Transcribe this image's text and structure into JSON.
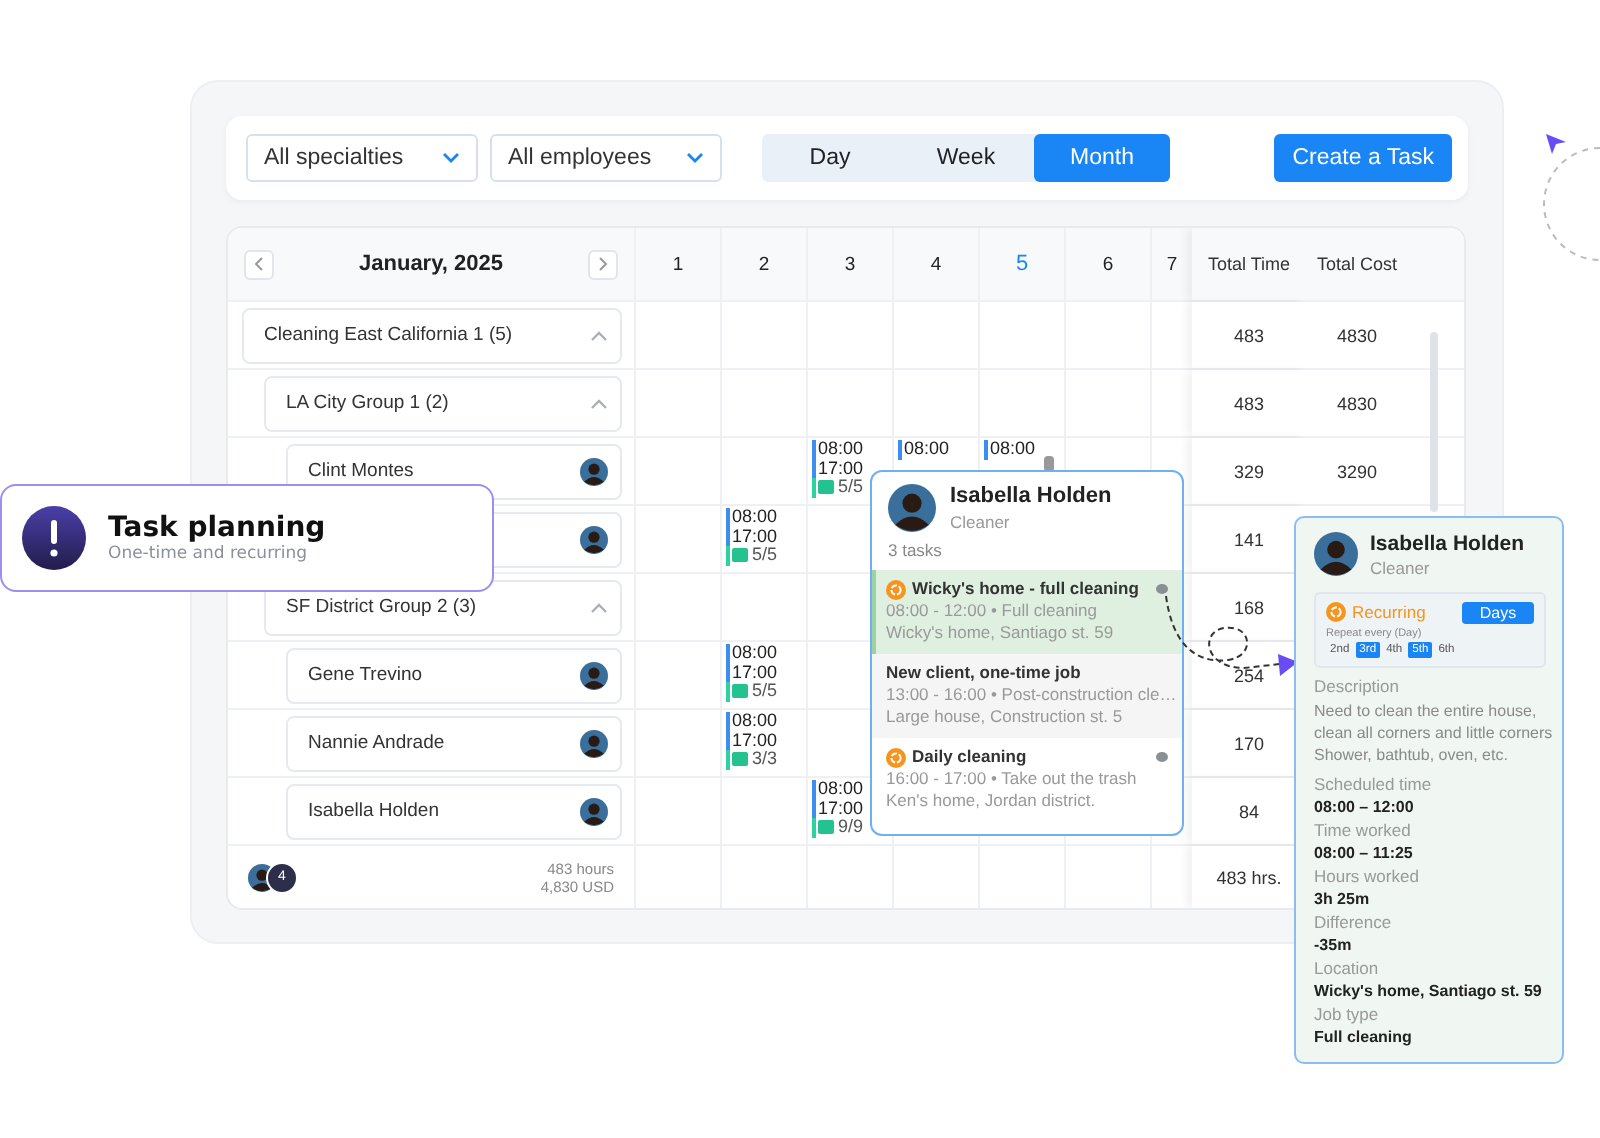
{
  "toolbar": {
    "filters": [
      {
        "value": "All specialties"
      },
      {
        "value": "All employees"
      }
    ],
    "views": [
      {
        "label": "Day",
        "selected": false
      },
      {
        "label": "Week",
        "selected": false
      },
      {
        "label": "Month",
        "selected": true
      }
    ],
    "create_button": "Create a Task"
  },
  "calendar": {
    "month": "January, 2025",
    "days": [
      {
        "label": "1",
        "selected": false
      },
      {
        "label": "2",
        "selected": false
      },
      {
        "label": "3",
        "selected": false
      },
      {
        "label": "4",
        "selected": false
      },
      {
        "label": "5",
        "selected": true
      },
      {
        "label": "6",
        "selected": false
      },
      {
        "label": "7",
        "selected": false
      }
    ],
    "total_columns": [
      "Total Time",
      "Total Cost"
    ],
    "tree": [
      {
        "kind": "group",
        "label": "Cleaning East California 1 (5)",
        "expanded": true,
        "total_time": "483",
        "total_cost": "4830",
        "cells": [
          {
            "kind": "empty"
          },
          {
            "kind": "empty"
          },
          {
            "kind": "empty"
          },
          {
            "kind": "empty"
          },
          {
            "kind": "empty"
          },
          {
            "kind": "empty"
          },
          {
            "kind": "empty"
          }
        ],
        "children": [
          {
            "kind": "group",
            "label": "LA City Group 1 (2)",
            "expanded": true,
            "total_time": "483",
            "total_cost": "4830",
            "cells": [
              {
                "kind": "empty"
              },
              {
                "kind": "empty"
              },
              {
                "kind": "empty"
              },
              {
                "kind": "empty"
              },
              {
                "kind": "empty"
              },
              {
                "kind": "empty"
              },
              {
                "kind": "empty"
              }
            ],
            "children": [
              {
                "kind": "employee",
                "name": "Clint Montes",
                "total_time": "329",
                "total_cost": "3290",
                "cells": [
                  {
                    "kind": "empty"
                  },
                  {
                    "kind": "empty"
                  },
                  {
                    "kind": "shift",
                    "start": "08:00",
                    "end": "17:00",
                    "count": "5/5",
                    "note": false
                  },
                  {
                    "kind": "shift",
                    "start": "08:00",
                    "note": false
                  },
                  {
                    "kind": "shift",
                    "start": "08:00",
                    "note": true
                  },
                  {
                    "kind": "empty"
                  },
                  {
                    "kind": "empty"
                  }
                ]
              },
              {
                "kind": "employee",
                "total_time": "141",
                "cells": [
                  {
                    "kind": "empty"
                  },
                  {
                    "kind": "shift",
                    "start": "08:00",
                    "end": "17:00",
                    "count": "5/5",
                    "note": false
                  },
                  {
                    "kind": "empty"
                  },
                  {
                    "kind": "empty"
                  },
                  {
                    "kind": "empty"
                  },
                  {
                    "kind": "empty"
                  },
                  {
                    "kind": "empty"
                  }
                ]
              }
            ]
          },
          {
            "kind": "group",
            "label": "SF District Group 2 (3)",
            "expanded": true,
            "total_time": "168",
            "cells": [
              {
                "kind": "empty"
              },
              {
                "kind": "empty"
              },
              {
                "kind": "empty"
              },
              {
                "kind": "empty"
              },
              {
                "kind": "empty"
              },
              {
                "kind": "empty"
              },
              {
                "kind": "empty"
              }
            ],
            "children": [
              {
                "kind": "employee",
                "name": "Gene Trevino",
                "total_time": "254",
                "cells": [
                  {
                    "kind": "empty"
                  },
                  {
                    "kind": "shift",
                    "start": "08:00",
                    "end": "17:00",
                    "count": "5/5",
                    "note": false
                  },
                  {
                    "kind": "empty"
                  },
                  {
                    "kind": "empty"
                  },
                  {
                    "kind": "empty"
                  },
                  {
                    "kind": "empty"
                  },
                  {
                    "kind": "empty"
                  }
                ]
              },
              {
                "kind": "employee",
                "name": "Nannie Andrade",
                "total_time": "170",
                "cells": [
                  {
                    "kind": "empty"
                  },
                  {
                    "kind": "shift",
                    "start": "08:00",
                    "end": "17:00",
                    "count": "3/3",
                    "note": false
                  },
                  {
                    "kind": "empty"
                  },
                  {
                    "kind": "empty"
                  },
                  {
                    "kind": "empty"
                  },
                  {
                    "kind": "empty"
                  },
                  {
                    "kind": "empty"
                  }
                ]
              },
              {
                "kind": "employee",
                "name": "Isabella Holden",
                "total_time": "84",
                "cells": [
                  {
                    "kind": "empty"
                  },
                  {
                    "kind": "empty"
                  },
                  {
                    "kind": "shift",
                    "start": "08:00",
                    "end": "17:00",
                    "count": "9/9",
                    "note": false
                  },
                  {
                    "kind": "empty"
                  },
                  {
                    "kind": "empty"
                  },
                  {
                    "kind": "empty"
                  },
                  {
                    "kind": "empty"
                  }
                ]
              }
            ]
          }
        ]
      }
    ],
    "footer": {
      "extra_count": "4",
      "hours": "483 hours",
      "cost": "4,830 USD",
      "total_time": "483 hrs."
    }
  },
  "promo_card": {
    "title": "Task planning",
    "subtitle": "One-time and recurring"
  },
  "popup": {
    "name": "Isabella Holden",
    "role": "Cleaner",
    "task_count": "3 tasks",
    "tasks": [
      {
        "kind": "recurring",
        "selected": true,
        "title": "Wicky's home - full cleaning",
        "time": "08:00 - 12:00 • Full cleaning",
        "place": "Wicky's home, Santiago st. 59"
      },
      {
        "kind": "one-time",
        "selected": false,
        "title": "New client, one-time job",
        "time": "13:00 - 16:00 • Post-construction cle…",
        "place": "Large house, Construction st. 5"
      },
      {
        "kind": "recurring",
        "selected": false,
        "title": "Daily cleaning",
        "time": "16:00 - 17:00 • Take out the trash",
        "place": "Ken's home, Jordan district."
      }
    ]
  },
  "detail": {
    "name": "Isabella Holden",
    "role": "Cleaner",
    "recurrence": "Recurring",
    "unit_button": "Days",
    "repeat_label": "Repeat every (Day)",
    "repeat_days": [
      {
        "label": "2nd",
        "selected": false
      },
      {
        "label": "3rd",
        "selected": true
      },
      {
        "label": "4th",
        "selected": false
      },
      {
        "label": "5th",
        "selected": true
      },
      {
        "label": "6th",
        "selected": false
      }
    ],
    "description_label": "Description",
    "description": "Need to clean the entire house, clean all corners and little corners Shower, bathtub, oven, etc.",
    "fields": [
      {
        "label": "Scheduled time",
        "value": "08:00 – 12:00"
      },
      {
        "label": "Time worked",
        "value": "08:00 – 11:25"
      },
      {
        "label": "Hours worked",
        "value": "3h 25m"
      },
      {
        "label": "Difference",
        "value": "-35m"
      },
      {
        "label": "Location",
        "value": "Wicky's home, Santiago st. 59"
      },
      {
        "label": "Job type",
        "value": "Full cleaning"
      }
    ]
  }
}
